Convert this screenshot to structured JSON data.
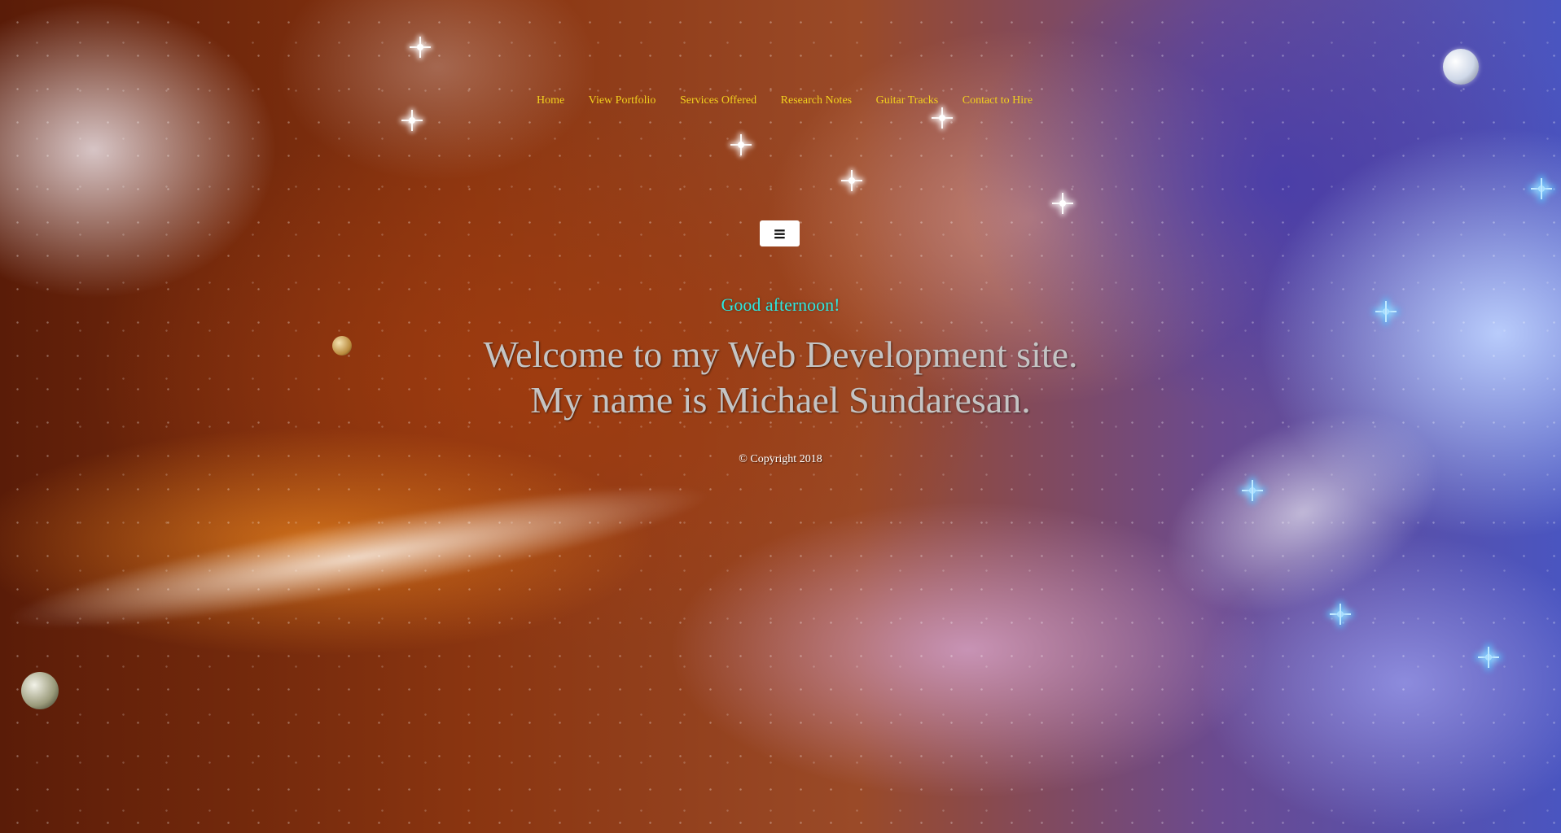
{
  "nav": {
    "items": [
      {
        "label": "Home"
      },
      {
        "label": "View Portfolio"
      },
      {
        "label": "Services Offered"
      },
      {
        "label": "Research Notes"
      },
      {
        "label": "Guitar Tracks"
      },
      {
        "label": "Contact to Hire"
      }
    ]
  },
  "menu_toggle": {
    "icon": "hamburger-menu-icon",
    "glyph": "≡"
  },
  "hero": {
    "greeting": "Good afternoon!",
    "welcome_line1": "Welcome to my Web Development site.",
    "welcome_line2": "My name is Michael Sundaresan."
  },
  "footer": {
    "copyright": "© Copyright 2018"
  },
  "colors": {
    "nav_link": "#f2d01e",
    "greeting": "#2ee8e0",
    "welcome_text": "#c4c4c4",
    "copyright": "#ffffff"
  }
}
